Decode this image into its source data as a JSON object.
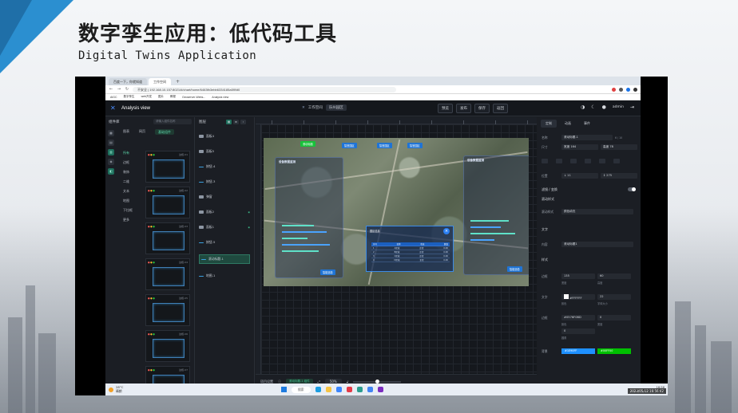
{
  "slide": {
    "title": "数字孪生应用：低代码工具",
    "subtitle": "Digital Twins Application"
  },
  "browser": {
    "tabs": [
      {
        "label": "百度一下，你就知道",
        "active": false
      },
      {
        "label": "工作空间",
        "active": true
      }
    ],
    "new_tab": "+",
    "url": "不安全 | 192.168.10.157:8021/#/chart/home/6463fb3ebb6334185a59Nt0",
    "bookmarks": [
      "AIGC",
      "数字孪生",
      "web开发",
      "图片",
      "教程",
      "Geoserver-Webs...",
      "Analysis view"
    ]
  },
  "app": {
    "logo": "Analysis view",
    "breadcrumb": [
      "工作空间",
      "乐州园区"
    ],
    "actions": [
      "预览",
      "发布",
      "保存",
      "返回"
    ],
    "user": "admin"
  },
  "component_panel": {
    "title": "组件库",
    "search_placeholder": "请输入组件名称",
    "top_categories": [
      "图表",
      "网页",
      "基础组件"
    ],
    "sub_categories": [
      "所有",
      "边框",
      "装饰",
      "二维",
      "文本",
      "地图",
      "下拉框",
      "更多"
    ],
    "cards": [
      "边框-01",
      "边框-02",
      "边框-03",
      "边框-04",
      "边框-05",
      "边框-06",
      "边框-07"
    ]
  },
  "layer_panel": {
    "title": "图层",
    "items": [
      {
        "name": "面板4",
        "type": "folder",
        "selected": false
      },
      {
        "name": "面板5",
        "type": "folder",
        "selected": false
      },
      {
        "name": "按钮-4",
        "type": "line",
        "selected": false
      },
      {
        "name": "按钮-3",
        "type": "line",
        "selected": false
      },
      {
        "name": "弹窗",
        "type": "folder",
        "selected": false
      },
      {
        "name": "面板2",
        "type": "folder",
        "selected": false
      },
      {
        "name": "面板1",
        "type": "folder",
        "selected": false
      },
      {
        "name": "按钮-5",
        "type": "line",
        "selected": false
      },
      {
        "name": "滚动标题-1",
        "type": "line",
        "selected": true
      },
      {
        "name": "地图-1",
        "type": "line",
        "selected": false
      }
    ]
  },
  "canvas": {
    "map_buttons": [
      "滚动标题",
      "智慧园区",
      "智慧园区",
      "智慧园区"
    ],
    "panel_title_left": "设备数据监测",
    "panel_title_right": "设备数据监测",
    "popup_title": "园区信息",
    "popup_close": "×",
    "table_head": [
      "序号",
      "名称",
      "状态",
      "数值"
    ],
    "table_rows": [
      [
        "1",
        "A区域",
        "正常",
        "0.00"
      ],
      [
        "2",
        "B区域",
        "正常",
        "0.00"
      ],
      [
        "3",
        "C区域",
        "正常",
        "0.00"
      ],
      [
        "4",
        "D区域",
        "正常",
        "0.00"
      ]
    ],
    "left_bottom_btn": "智能巡检",
    "right_bottom_btn": "智能巡检",
    "footer_label": "项目设置",
    "footer_tag": "滚动标题-1 组件",
    "zoom": "50%"
  },
  "prop_panel": {
    "tabs": [
      "定制",
      "动画",
      "事件"
    ],
    "name_label": "名称",
    "name_value": "滚动标题-1",
    "name_count": "6 / 10",
    "size_label": "尺寸",
    "width_value": "宽度 164",
    "height_value": "高度 78",
    "pos_label": "位置",
    "pos_x": "↓ 11",
    "pos_y": "↕ 275",
    "section_filter": "滤镜 / 变换",
    "section_scroll": "滚动样式",
    "scroll_type_label": "滚动样式",
    "scroll_type_value": "颜色填充",
    "section_text": "文字",
    "content_label": "内容",
    "content_value": "滚动标题1",
    "section_style": "样式",
    "border_label": "边框",
    "border_w": "135",
    "border_h": "60",
    "border_w_sub": "宽度",
    "border_h_sub": "高度",
    "text_label": "文字",
    "text_color": "#FFFFFF",
    "font_size": "22",
    "text_sub": "颜色",
    "font_sub": "字体大小",
    "border2_label": "边框",
    "border_color": "#0576F0BD",
    "border_width": "0",
    "border_color_sub": "颜色",
    "border_width_sub": "宽度",
    "radius_value": "0",
    "radius_sub": "圆角",
    "bg_label": "背景",
    "bg_color_1": "#1E90FF",
    "bg_color_2": "#00FF00"
  },
  "taskbar": {
    "weather_temp": "28°C",
    "weather_text": "晴朗",
    "search": "搜索",
    "time": "16:56",
    "date": "2023/5/12",
    "stamp": "2023/05/12 16:56:42"
  }
}
